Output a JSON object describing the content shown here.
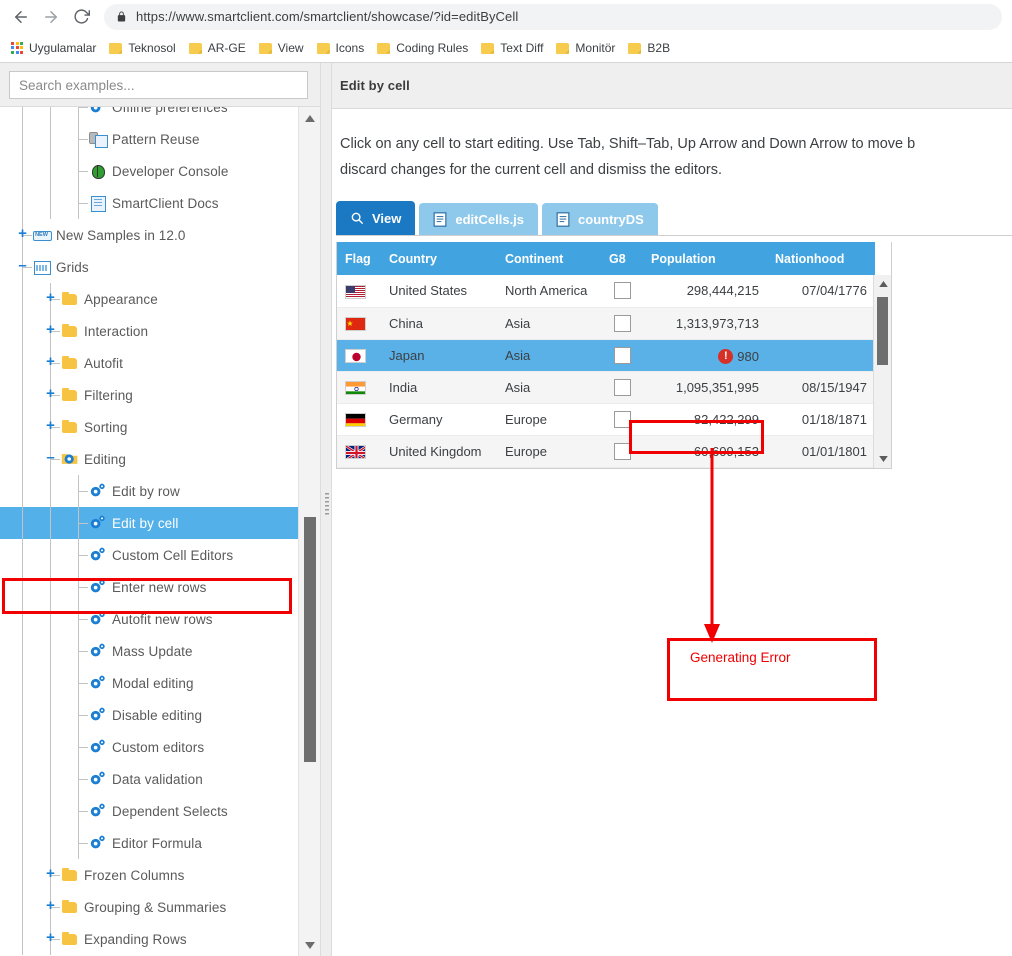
{
  "browser": {
    "back_icon": "back-arrow-icon",
    "forward_icon": "forward-arrow-icon",
    "reload_icon": "reload-icon",
    "lock_icon": "lock-icon",
    "url": "https://www.smartclient.com/smartclient/showcase/?id=editByCell",
    "bookmarks": [
      {
        "label": "Uygulamalar",
        "icon": "apps-grid-icon"
      },
      {
        "label": "Teknosol",
        "icon": "folder-icon"
      },
      {
        "label": "AR-GE",
        "icon": "folder-icon"
      },
      {
        "label": "View",
        "icon": "folder-icon"
      },
      {
        "label": "Icons",
        "icon": "folder-icon"
      },
      {
        "label": "Coding Rules",
        "icon": "folder-icon"
      },
      {
        "label": "Text Diff",
        "icon": "folder-icon"
      },
      {
        "label": "Monitör",
        "icon": "folder-icon"
      },
      {
        "label": "B2B",
        "icon": "folder-icon"
      }
    ]
  },
  "sidebar": {
    "search_placeholder": "Search examples...",
    "search_value": "",
    "scroll_up_icon": "chevron-up-icon",
    "scroll_down_icon": "chevron-down-icon",
    "tree": [
      {
        "label": "Offline preferences",
        "icon": "gear-icon",
        "indent": 2,
        "toggle": "",
        "clipped": true
      },
      {
        "label": "Pattern Reuse",
        "icon": "pattern-icon",
        "indent": 2,
        "toggle": ""
      },
      {
        "label": "Developer Console",
        "icon": "bug-icon",
        "indent": 2,
        "toggle": ""
      },
      {
        "label": "SmartClient Docs",
        "icon": "doc-icon",
        "indent": 2,
        "toggle": ""
      },
      {
        "label": "New Samples in 12.0",
        "icon": "new-badge-icon",
        "indent": 0,
        "toggle": "+"
      },
      {
        "label": "Grids",
        "icon": "grid-icon",
        "indent": 0,
        "toggle": "-"
      },
      {
        "label": "Appearance",
        "icon": "folder-icon",
        "indent": 1,
        "toggle": "+"
      },
      {
        "label": "Interaction",
        "icon": "folder-icon",
        "indent": 1,
        "toggle": "+"
      },
      {
        "label": "Autofit",
        "icon": "folder-icon",
        "indent": 1,
        "toggle": "+"
      },
      {
        "label": "Filtering",
        "icon": "folder-icon",
        "indent": 1,
        "toggle": "+"
      },
      {
        "label": "Sorting",
        "icon": "folder-icon",
        "indent": 1,
        "toggle": "+"
      },
      {
        "label": "Editing",
        "icon": "folder-gear-icon",
        "indent": 1,
        "toggle": "-"
      },
      {
        "label": "Edit by row",
        "icon": "gear-icon",
        "indent": 2,
        "toggle": ""
      },
      {
        "label": "Edit by cell",
        "icon": "gear-icon",
        "indent": 2,
        "toggle": "",
        "selected": true
      },
      {
        "label": "Custom Cell Editors",
        "icon": "gear-icon",
        "indent": 2,
        "toggle": ""
      },
      {
        "label": "Enter new rows",
        "icon": "gear-icon",
        "indent": 2,
        "toggle": ""
      },
      {
        "label": "Autofit new rows",
        "icon": "gear-icon",
        "indent": 2,
        "toggle": ""
      },
      {
        "label": "Mass Update",
        "icon": "gear-icon",
        "indent": 2,
        "toggle": ""
      },
      {
        "label": "Modal editing",
        "icon": "gear-icon",
        "indent": 2,
        "toggle": ""
      },
      {
        "label": "Disable editing",
        "icon": "gear-icon",
        "indent": 2,
        "toggle": ""
      },
      {
        "label": "Custom editors",
        "icon": "gear-icon",
        "indent": 2,
        "toggle": ""
      },
      {
        "label": "Data validation",
        "icon": "gear-icon",
        "indent": 2,
        "toggle": ""
      },
      {
        "label": "Dependent Selects",
        "icon": "gear-icon",
        "indent": 2,
        "toggle": ""
      },
      {
        "label": "Editor Formula",
        "icon": "gear-icon",
        "indent": 2,
        "toggle": ""
      },
      {
        "label": "Frozen Columns",
        "icon": "folder-icon",
        "indent": 1,
        "toggle": "+"
      },
      {
        "label": "Grouping & Summaries",
        "icon": "folder-icon",
        "indent": 1,
        "toggle": "+"
      },
      {
        "label": "Expanding Rows",
        "icon": "folder-icon",
        "indent": 1,
        "toggle": "+",
        "clipped": true
      }
    ]
  },
  "content": {
    "title": "Edit by cell",
    "intro": "Click on any cell to start editing. Use Tab, Shift–Tab, Up Arrow and Down Arrow to move b",
    "intro_line2": "discard changes for the current cell and dismiss the editors.",
    "tabs": [
      {
        "label": "View",
        "icon": "magnifier-icon",
        "active": true
      },
      {
        "label": "editCells.js",
        "icon": "source-file-icon",
        "active": false
      },
      {
        "label": "countryDS",
        "icon": "source-file-icon",
        "active": false
      }
    ],
    "grid": {
      "columns": [
        "Flag",
        "Country",
        "Continent",
        "G8",
        "Population",
        "Nationhood"
      ],
      "rows": [
        {
          "flag": "us",
          "country": "United States",
          "continent": "North America",
          "g8": false,
          "population": "298,444,215",
          "nationhood": "07/04/1776",
          "selected": false
        },
        {
          "flag": "cn",
          "country": "China",
          "continent": "Asia",
          "g8": false,
          "population": "1,313,973,713",
          "nationhood": "",
          "selected": false
        },
        {
          "flag": "jp",
          "country": "Japan",
          "continent": "Asia",
          "g8": false,
          "population": "980",
          "nationhood": "",
          "selected": true,
          "error": true
        },
        {
          "flag": "in",
          "country": "India",
          "continent": "Asia",
          "g8": false,
          "population": "1,095,351,995",
          "nationhood": "08/15/1947",
          "selected": false
        },
        {
          "flag": "de",
          "country": "Germany",
          "continent": "Europe",
          "g8": false,
          "population": "82,422,299",
          "nationhood": "01/18/1871",
          "selected": false
        },
        {
          "flag": "gb",
          "country": "United Kingdom",
          "continent": "Europe",
          "g8": false,
          "population": "60,609,153",
          "nationhood": "01/01/1801",
          "selected": false
        }
      ],
      "error_badge": "!",
      "scroll_up_icon": "chevron-up-icon",
      "scroll_down_icon": "chevron-down-icon"
    }
  },
  "annotations": {
    "callout_label": "Generating Error",
    "accent_color": "#f00000",
    "selection_color": "#54b0e8",
    "header_color": "#41a3e0",
    "active_tab_color": "#1b78c2",
    "inactive_tab_color": "#8ec8ea"
  }
}
